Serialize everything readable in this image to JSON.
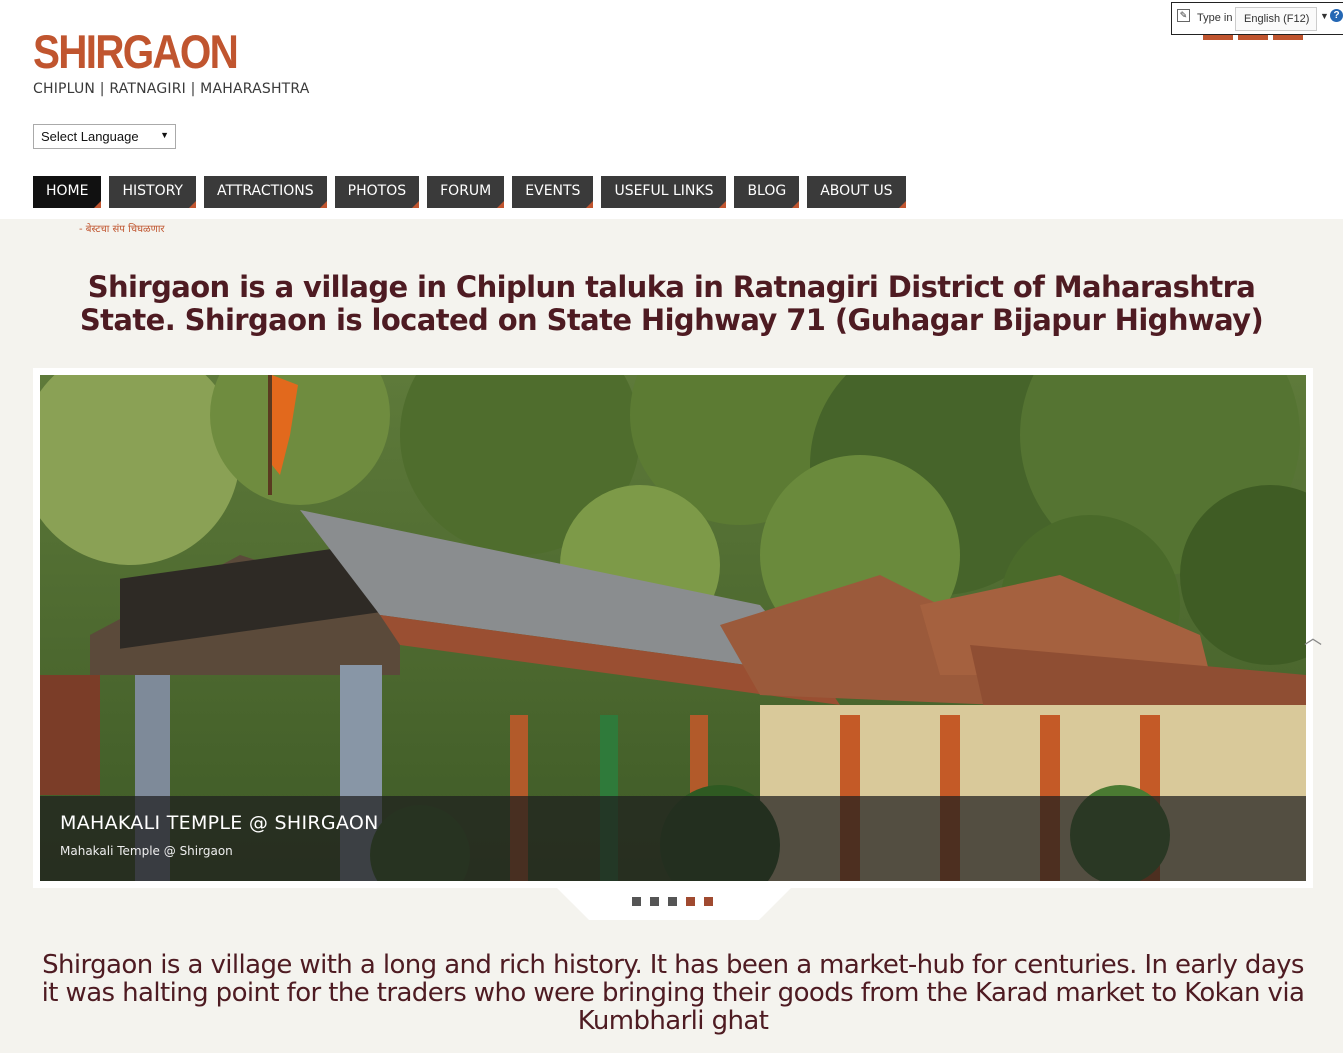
{
  "site": {
    "title": "SHIRGAON",
    "tagline": "CHIPLUN | RATNAGIRI | MAHARASHTRA"
  },
  "language_select": {
    "selected": "Select Language"
  },
  "type_in_widget": {
    "label": "Type in",
    "language": "English (F12)",
    "help": "?"
  },
  "nav": {
    "items": [
      {
        "label": "HOME",
        "active": true
      },
      {
        "label": "HISTORY"
      },
      {
        "label": "ATTRACTIONS"
      },
      {
        "label": "PHOTOS"
      },
      {
        "label": "FORUM"
      },
      {
        "label": "EVENTS"
      },
      {
        "label": "USEFUL LINKS"
      },
      {
        "label": "BLOG"
      },
      {
        "label": "ABOUT US"
      }
    ]
  },
  "ticker": "- बेस्टचा संप चिघळणार",
  "headline": "Shirgaon is a village in Chiplun taluka in Ratnagiri District of Maharashtra State. Shirgaon is located on State Highway 71 (Guhagar Bijapur Highway)",
  "slider": {
    "caption_title": "MAHAKALI TEMPLE @ SHIRGAON",
    "caption_subtitle": "Mahakali Temple @ Shirgaon",
    "slide_count": 5,
    "active_slide": 4
  },
  "history_text": "Shirgaon is a village with a long and rich history. It has been a market-hub for centuries. In early days it was halting point for the traders who were bringing their goods from the Karad market to Kokan via Kumbharli ghat",
  "colors": {
    "brand": "#c0552f",
    "heading": "#4e1b22",
    "nav_bg": "#3a3a3a",
    "band_bg": "#f4f3ee"
  }
}
